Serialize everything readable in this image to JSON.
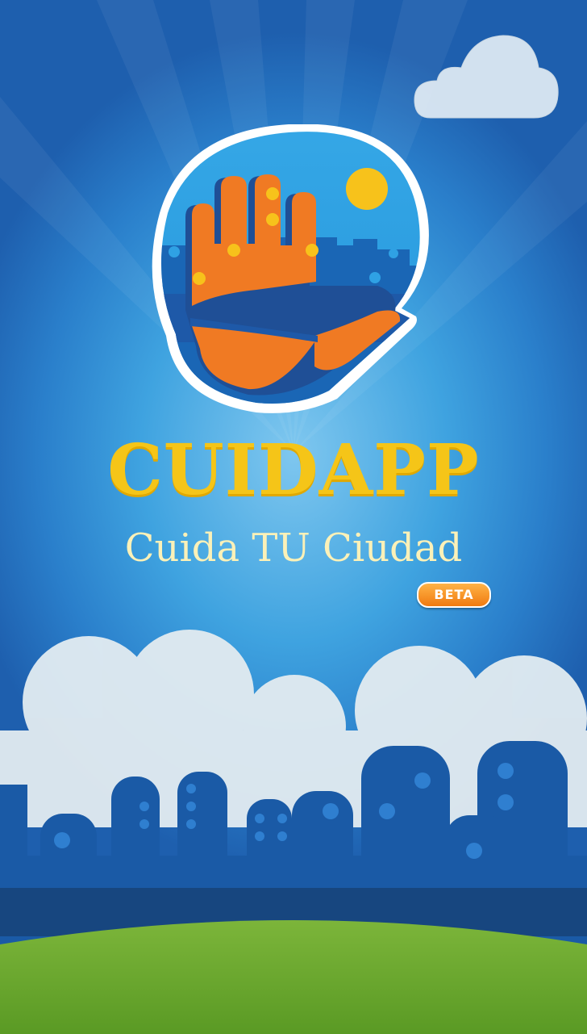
{
  "app": {
    "name": "CUIDAPP",
    "tagline": "Cuida TU Ciudad",
    "badge": "BETA"
  },
  "icons": {
    "logo": "hand-speech-bubble-icon",
    "small_cloud": "cloud-icon"
  },
  "colors": {
    "sky": "#2a8ad8",
    "brand_yellow": "#f5c518",
    "tagline_cream": "#fbf1b8",
    "badge_orange": "#f07a10",
    "hand_orange": "#f07a23",
    "city_blue": "#1a5aa6",
    "grass_green": "#6aa82c"
  }
}
